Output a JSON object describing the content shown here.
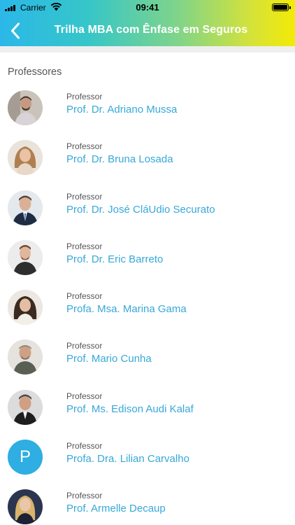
{
  "status_bar": {
    "carrier": "Carrier",
    "time": "09:41"
  },
  "nav": {
    "back_icon": "chevron-left-icon",
    "title": "Trilha MBA com Ênfase em Seguros"
  },
  "section": {
    "title": "Professores"
  },
  "colors": {
    "accent": "#37a8d8",
    "gradient_start": "#2bb8e9",
    "gradient_end": "#f3ea06",
    "avatar_fallback": "#2eaee2"
  },
  "professors": [
    {
      "role": "Professor",
      "name": "Prof. Dr. Adriano Mussa",
      "avatar": "photo"
    },
    {
      "role": "Professor",
      "name": "Prof. Dr. Bruna Losada",
      "avatar": "photo"
    },
    {
      "role": "Professor",
      "name": "Prof. Dr. José CláUdio Securato",
      "avatar": "photo"
    },
    {
      "role": "Professor",
      "name": "Prof. Dr. Eric Barreto",
      "avatar": "photo"
    },
    {
      "role": "Professor",
      "name": "Profa. Msa. Marina Gama",
      "avatar": "photo"
    },
    {
      "role": "Professor",
      "name": "Prof. Mario Cunha",
      "avatar": "photo"
    },
    {
      "role": "Professor",
      "name": "Prof. Ms. Edison Audi Kalaf",
      "avatar": "photo"
    },
    {
      "role": "Professor",
      "name": "Profa. Dra. Lilian Carvalho",
      "avatar": "letter",
      "initial": "P"
    },
    {
      "role": "Professor",
      "name": "Prof. Armelle Decaup",
      "avatar": "photo"
    }
  ]
}
